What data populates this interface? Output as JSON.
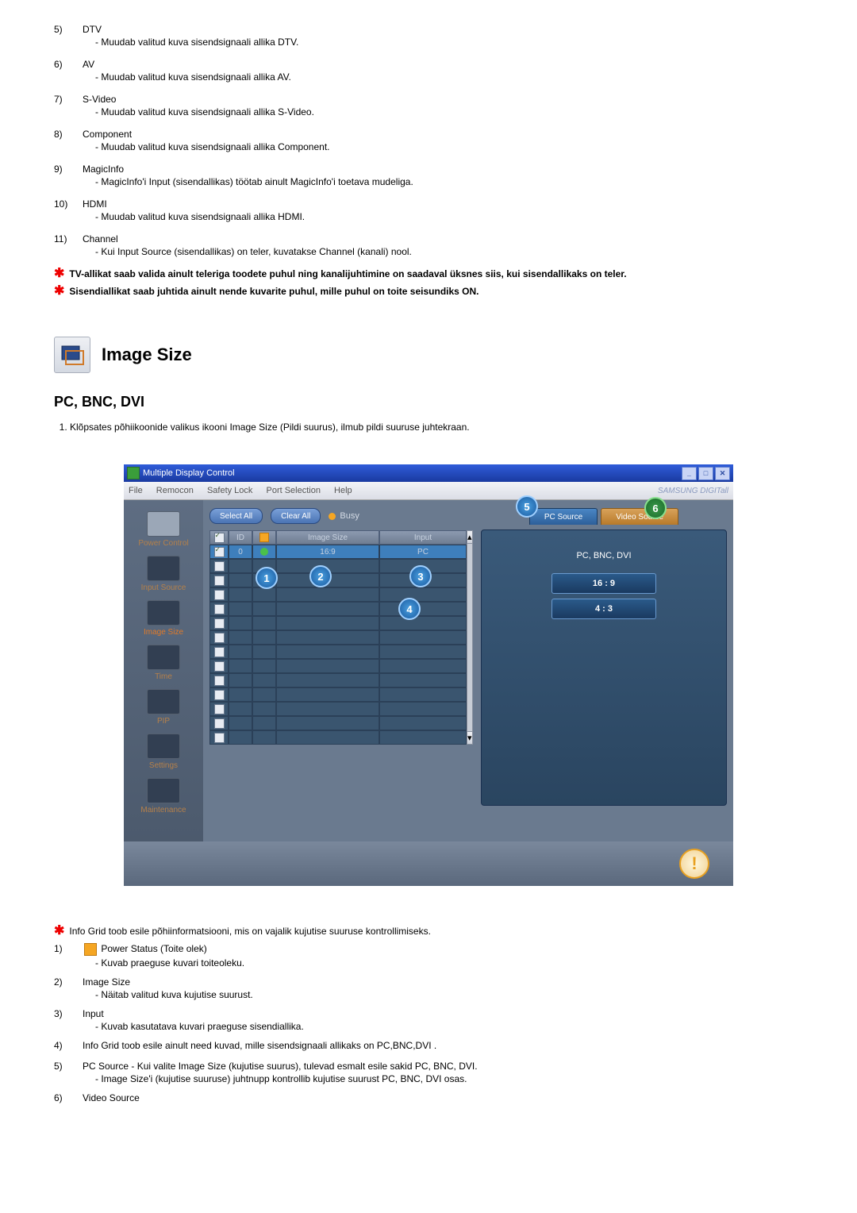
{
  "list_top": [
    {
      "num": "5)",
      "title": "DTV",
      "desc": "- Muudab valitud kuva sisendsignaali allika DTV."
    },
    {
      "num": "6)",
      "title": "AV",
      "desc": "- Muudab valitud kuva sisendsignaali allika AV."
    },
    {
      "num": "7)",
      "title": "S-Video",
      "desc": "- Muudab valitud kuva sisendsignaali allika S-Video."
    },
    {
      "num": "8)",
      "title": "Component",
      "desc": "- Muudab valitud kuva sisendsignaali allika Component."
    },
    {
      "num": "9)",
      "title": "MagicInfo",
      "desc": "- MagicInfo'i Input (sisendallikas) töötab ainult MagicInfo'i toetava mudeliga."
    },
    {
      "num": "10)",
      "title": "HDMI",
      "desc": "- Muudab valitud kuva sisendsignaali allika HDMI."
    },
    {
      "num": "11)",
      "title": "Channel",
      "desc": "- Kui Input Source (sisendallikas) on teler, kuvatakse Channel (kanali) nool."
    }
  ],
  "top_notes": [
    "TV-allikat saab valida ainult teleriga toodete puhul ning kanalijuhtimine on saadaval üksnes siis, kui sisendallikaks on teler.",
    "Sisendiallikat saab juhtida ainult nende kuvarite puhul, mille puhul on toite seisundiks ON."
  ],
  "section_title": "Image Size",
  "sub_title": "PC, BNC, DVI",
  "step1": "Klõpsates põhiikoonide valikus ikooni Image Size (Pildi suurus), ilmub pildi suuruse juhtekraan.",
  "app": {
    "title": "Multiple Display Control",
    "menu": [
      "File",
      "Remocon",
      "Safety Lock",
      "Port Selection",
      "Help"
    ],
    "brand": "SAMSUNG DIGITall",
    "buttons": {
      "select_all": "Select All",
      "clear_all": "Clear All",
      "busy": "Busy"
    },
    "cols": {
      "id": "ID",
      "size": "Image Size",
      "input": "Input"
    },
    "row0": {
      "id": "0",
      "size": "16:9",
      "input": "PC"
    },
    "sidebar": [
      "Power Control",
      "Input Source",
      "Image Size",
      "Time",
      "PIP",
      "Settings",
      "Maintenance"
    ],
    "tabs": {
      "pc": "PC Source",
      "video": "Video Source"
    },
    "right_label": "PC, BNC, DVI",
    "right_btns": [
      "16 : 9",
      "4 : 3"
    ]
  },
  "below_note": "Info Grid toob esile põhiinformatsiooni, mis on vajalik kujutise suuruse kontrollimiseks.",
  "list_bottom": [
    {
      "num": "1)",
      "title": "Power Status (Toite olek)",
      "desc": "- Kuvab praeguse kuvari toiteoleku.",
      "icon": true
    },
    {
      "num": "2)",
      "title": "Image Size",
      "desc": "- Näitab valitud kuva kujutise suurust."
    },
    {
      "num": "3)",
      "title": "Input",
      "desc": "- Kuvab kasutatava kuvari praeguse sisendiallika."
    },
    {
      "num": "4)",
      "title": "Info Grid toob esile ainult need kuvad, mille sisendsignaali allikaks on PC,BNC,DVI .",
      "desc": ""
    },
    {
      "num": "5)",
      "title": "PC Source - Kui valite Image Size (kujutise suurus), tulevad esmalt esile sakid PC, BNC, DVI.",
      "desc": "- Image Size'i (kujutise suuruse) juhtnupp kontrollib kujutise suurust PC, BNC, DVI osas."
    },
    {
      "num": "6)",
      "title": "Video Source",
      "desc": ""
    }
  ]
}
